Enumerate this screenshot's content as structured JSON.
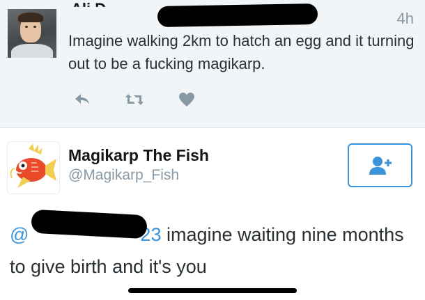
{
  "tweet_top": {
    "author_name_partial": "Ali D",
    "time": "4h",
    "text": "Imagine walking 2km to hatch an egg and it turning out to be a fucking magikarp.",
    "actions": [
      "reply-icon",
      "retweet-icon",
      "like-icon"
    ]
  },
  "tweet_bottom": {
    "author_name": "Magikarp The Fish",
    "handle": "@Magikarp_Fish",
    "mention_prefix": "@",
    "mention_suffix": "23",
    "text": " imagine waiting nine months to give birth and it's you",
    "follow_icon": "add-user-icon"
  },
  "colors": {
    "accent": "#3b94d9",
    "muted": "#8899a6",
    "top_bg": "#f2f5f7"
  }
}
